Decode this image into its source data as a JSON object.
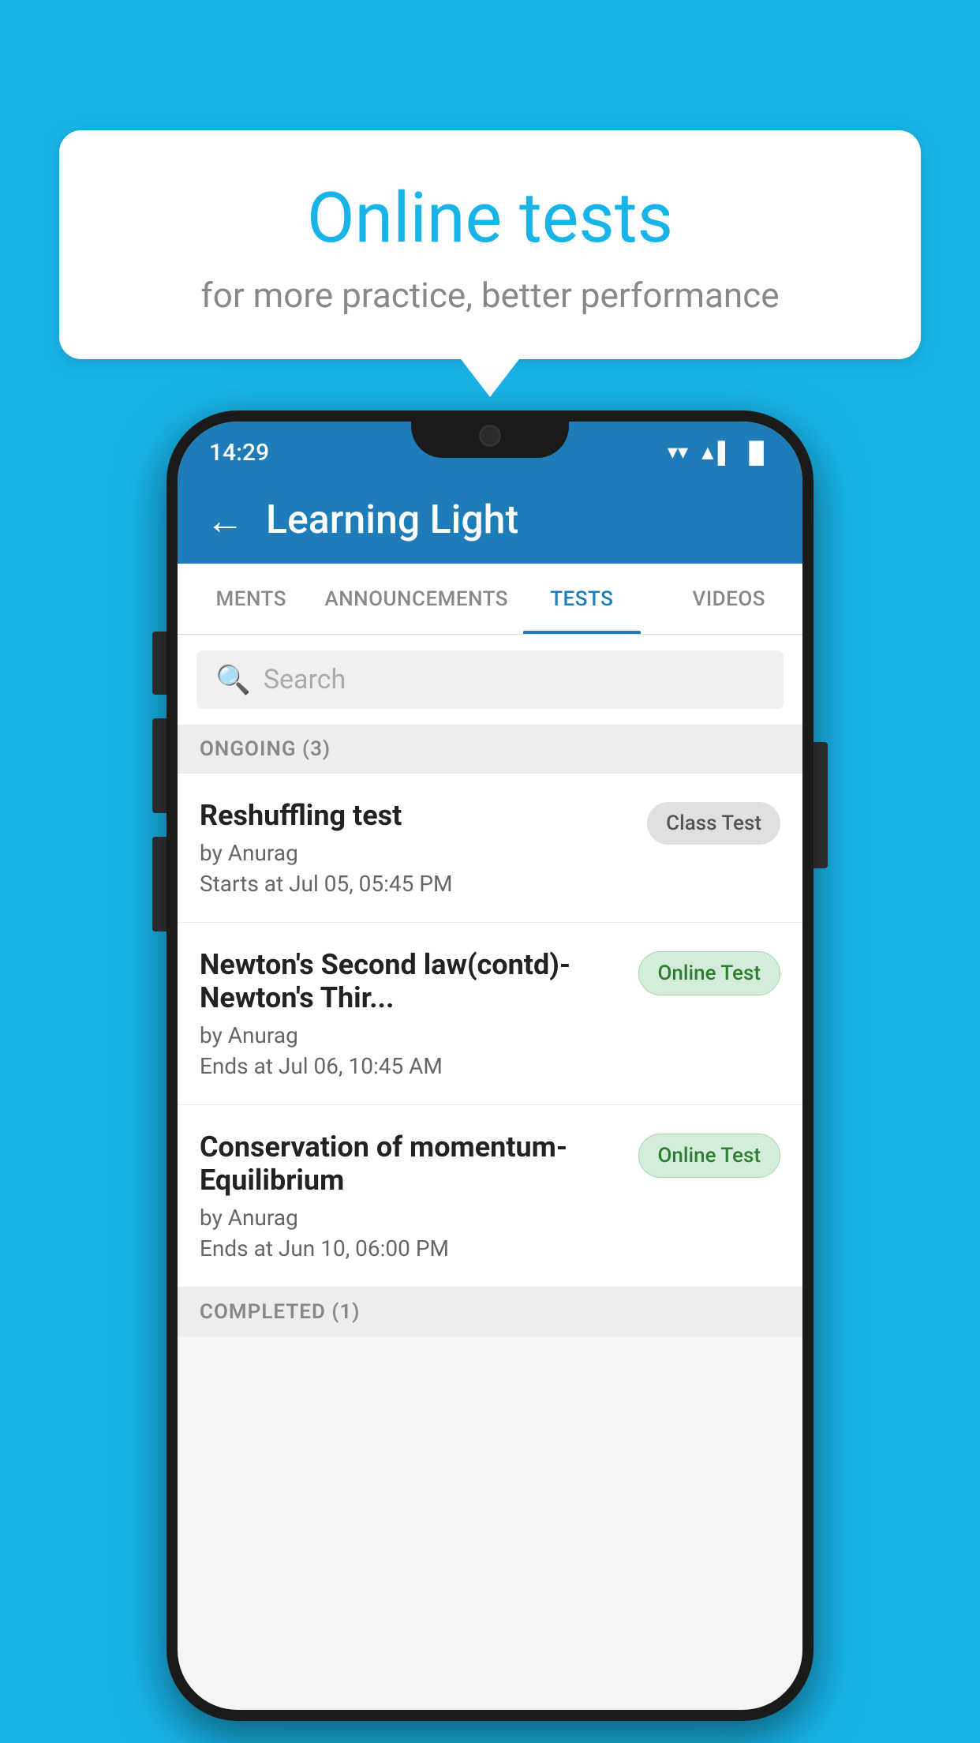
{
  "background_color": "#18b4e8",
  "speech_bubble": {
    "title": "Online tests",
    "subtitle": "for more practice, better performance"
  },
  "phone": {
    "status_bar": {
      "time": "14:29",
      "wifi": "▼",
      "signal": "▲",
      "battery": "▌"
    },
    "app_bar": {
      "title": "Learning Light",
      "back_label": "←"
    },
    "tabs": [
      {
        "label": "MENTS",
        "active": false
      },
      {
        "label": "ANNOUNCEMENTS",
        "active": false
      },
      {
        "label": "TESTS",
        "active": true
      },
      {
        "label": "VIDEOS",
        "active": false
      }
    ],
    "search": {
      "placeholder": "Search"
    },
    "ongoing_section": {
      "title": "ONGOING (3)"
    },
    "test_items": [
      {
        "name": "Reshuffling test",
        "author": "by Anurag",
        "date_label": "Starts at",
        "date": "Jul 05, 05:45 PM",
        "badge": "Class Test",
        "badge_type": "class"
      },
      {
        "name": "Newton's Second law(contd)-Newton's Thir...",
        "author": "by Anurag",
        "date_label": "Ends at",
        "date": "Jul 06, 10:45 AM",
        "badge": "Online Test",
        "badge_type": "online"
      },
      {
        "name": "Conservation of momentum-Equilibrium",
        "author": "by Anurag",
        "date_label": "Ends at",
        "date": "Jun 10, 06:00 PM",
        "badge": "Online Test",
        "badge_type": "online"
      }
    ],
    "completed_section": {
      "title": "COMPLETED (1)"
    }
  }
}
